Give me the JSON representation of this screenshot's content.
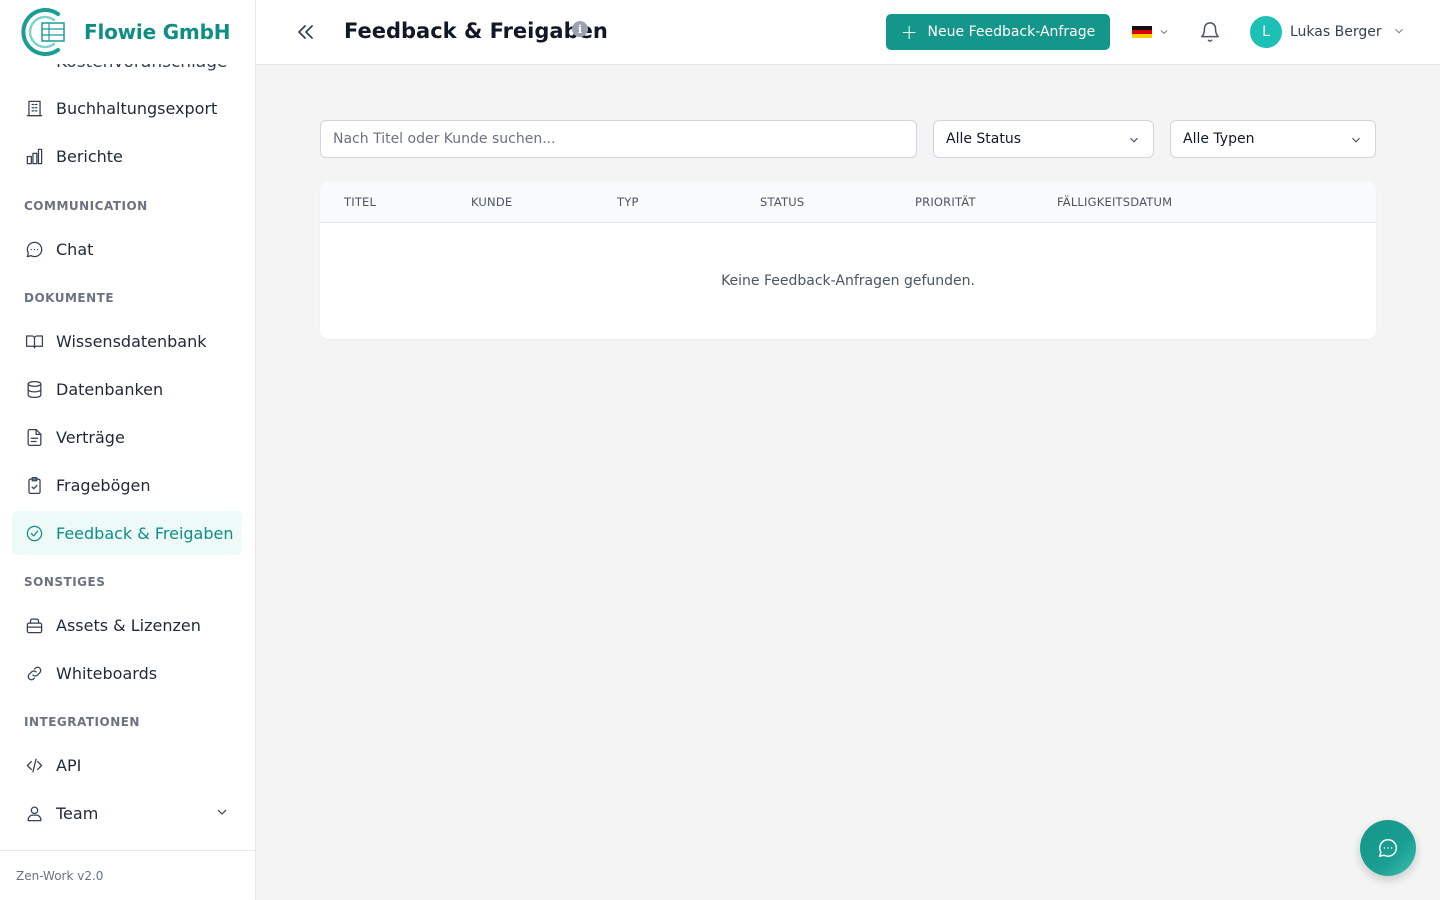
{
  "brand": {
    "name": "Flowie GmbH"
  },
  "sidebar": {
    "cut_item": "Kostenvoranschläge",
    "items": [
      {
        "label": "Buchhaltungsexport",
        "icon": "building-icon"
      },
      {
        "label": "Berichte",
        "icon": "bar-chart-icon"
      },
      {
        "label": "Chat",
        "icon": "chat-bubble-icon"
      },
      {
        "label": "Wissensdatenbank",
        "icon": "book-icon"
      },
      {
        "label": "Datenbanken",
        "icon": "database-icon"
      },
      {
        "label": "Verträge",
        "icon": "document-icon"
      },
      {
        "label": "Fragebögen",
        "icon": "clipboard-check-icon"
      },
      {
        "label": "Feedback & Freigaben",
        "icon": "check-circle-icon",
        "active": true
      },
      {
        "label": "Assets & Lizenzen",
        "icon": "briefcase-icon"
      },
      {
        "label": "Whiteboards",
        "icon": "link-icon"
      },
      {
        "label": "API",
        "icon": "code-icon"
      },
      {
        "label": "Team",
        "icon": "users-icon"
      }
    ],
    "sections": {
      "communication": "COMMUNICATION",
      "dokumente": "DOKUMENTE",
      "sonstiges": "SONSTIGES",
      "integrationen": "INTEGRATIONEN"
    },
    "footer": "Zen-Work v2.0"
  },
  "header": {
    "title": "Feedback & Freigaben",
    "info_glyph": "i",
    "new_button": "Neue Feedback-Anfrage",
    "user": {
      "initial": "L",
      "name": "Lukas Berger"
    }
  },
  "filters": {
    "search_placeholder": "Nach Titel oder Kunde suchen...",
    "status": "Alle Status",
    "type": "Alle Typen"
  },
  "table": {
    "columns": [
      "TITEL",
      "KUNDE",
      "TYP",
      "STATUS",
      "PRIORITÄT",
      "FÄLLIGKEITSDATUM"
    ],
    "empty": "Keine Feedback-Anfragen gefunden."
  },
  "colors": {
    "accent": "#14968a",
    "active_bg": "#eefaf8",
    "avatar": "#1cc0b5"
  }
}
